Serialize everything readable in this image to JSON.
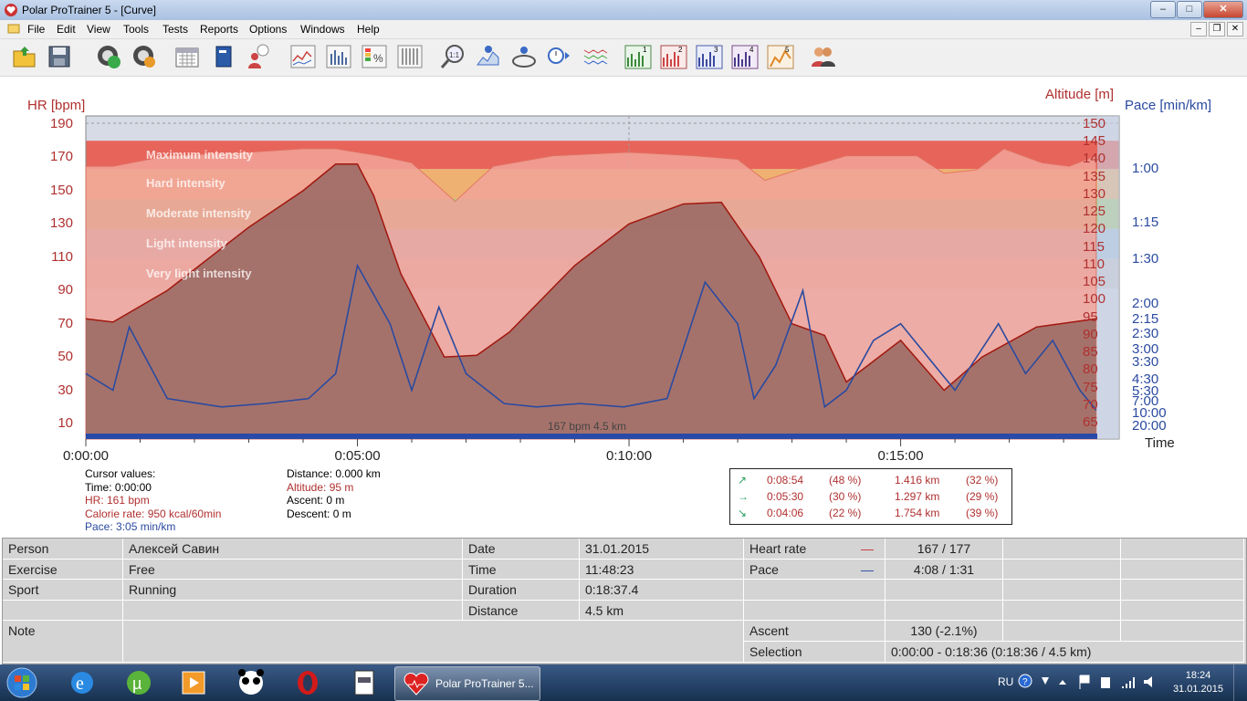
{
  "window": {
    "title": "Polar ProTrainer 5 - [Curve]",
    "min": "–",
    "max": "□",
    "close": "✕"
  },
  "menu": [
    "File",
    "Edit",
    "View",
    "Tools",
    "Tests",
    "Reports",
    "Options",
    "Windows",
    "Help"
  ],
  "mdi": {
    "min": "–",
    "restore": "❐",
    "close": "✕"
  },
  "toolbar_icons": [
    "open-folder-icon",
    "save-icon",
    "sync-icon",
    "settings-gear-icon",
    "calendar-icon",
    "book-icon",
    "person-idea-icon",
    "line-chart-icon",
    "bar-chart-icon",
    "percent-chart-icon",
    "table-icon",
    "zoom-1-1-icon",
    "info-chart-icon",
    "lap-info-icon",
    "timer-swap-icon",
    "multi-line-icon",
    "graph-1-icon",
    "graph-2-icon",
    "graph-3-icon",
    "graph-4-icon",
    "graph-5-icon",
    "users-icon"
  ],
  "toolbar_graph_numbers": [
    "1",
    "2",
    "3",
    "4",
    "5"
  ],
  "chart": {
    "left_axis_label": "HR [bpm]",
    "alt_axis_label": "Altitude [m]",
    "pace_axis_label": "Pace [min/km]",
    "x_axis_label": "Time",
    "hr_ticks": [
      190,
      170,
      150,
      130,
      110,
      90,
      70,
      50,
      30,
      10
    ],
    "alt_ticks": [
      150,
      145,
      140,
      135,
      130,
      125,
      120,
      115,
      110,
      105,
      100,
      95,
      90,
      85,
      80,
      75,
      70,
      65
    ],
    "pace_ticks": [
      "1:00",
      "1:15",
      "1:30",
      "2:00",
      "2:15",
      "2:30",
      "3:00",
      "3:30",
      "4:30",
      "5:30",
      "7:00",
      "10:00",
      "20:00"
    ],
    "x_ticks": [
      "0:00:00",
      "0:05:00",
      "0:10:00",
      "0:15:00"
    ],
    "zones": [
      {
        "label": "Maximum intensity",
        "color": "#e9574a"
      },
      {
        "label": "Hard intensity",
        "color": "#f1ac64"
      },
      {
        "label": "Moderate intensity",
        "color": "#a8c873"
      },
      {
        "label": "Light intensity",
        "color": "#a9c6dc"
      },
      {
        "label": "Very light intensity",
        "color": "#c9c9c9"
      }
    ],
    "bottom_note": "167 bpm 4.5 km",
    "colors": {
      "hr": "#a1180f",
      "pace": "#2a4aa0",
      "alt_fill": "#f2a49a",
      "alt_line": "#e07060",
      "hr_fill": "#9e6c66"
    }
  },
  "chart_data": {
    "type": "line",
    "x_label": "Time",
    "xlim_min": [
      0,
      18.6
    ],
    "series": [
      {
        "name": "HR [bpm]",
        "axis": "hr",
        "x": [
          0,
          0.5,
          1.5,
          3.0,
          4.0,
          4.6,
          5.0,
          5.3,
          5.8,
          6.6,
          7.2,
          7.8,
          9.0,
          10.0,
          11.0,
          11.7,
          12.4,
          13.0,
          13.6,
          14.0,
          15.0,
          15.8,
          16.5,
          17.5,
          18.6
        ],
        "y": [
          73,
          71,
          90,
          128,
          150,
          166,
          166,
          147,
          100,
          50,
          51,
          65,
          105,
          130,
          142,
          143,
          110,
          70,
          63,
          35,
          60,
          30,
          50,
          68,
          73
        ]
      },
      {
        "name": "Altitude [m]",
        "axis": "alt",
        "x": [
          0,
          0.5,
          1.5,
          3.0,
          4.0,
          4.6,
          5.4,
          6.0,
          6.8,
          7.5,
          8.6,
          10.0,
          11.2,
          12.0,
          12.5,
          13.1,
          14.0,
          15.3,
          15.8,
          16.4,
          16.9,
          17.6,
          18.1,
          18.6
        ],
        "y": [
          138,
          138,
          141,
          142,
          143,
          143,
          141,
          139,
          128,
          138,
          141,
          142,
          141,
          140,
          134,
          137,
          141,
          141,
          136,
          137,
          143,
          139,
          138,
          141
        ]
      },
      {
        "name": "Pace [min/km]",
        "axis": "hr",
        "x": [
          0,
          0.5,
          0.8,
          1.5,
          2.5,
          3.3,
          4.1,
          4.6,
          5.0,
          5.6,
          6.0,
          6.5,
          7.0,
          7.7,
          8.3,
          9.1,
          9.9,
          10.7,
          11.4,
          12.0,
          12.3,
          12.7,
          13.2,
          13.6,
          14.0,
          14.5,
          15.0,
          15.5,
          16.0,
          16.5,
          16.8,
          17.3,
          17.8,
          18.3,
          18.6
        ],
        "y": [
          40,
          30,
          68,
          25,
          20,
          22,
          25,
          40,
          105,
          70,
          30,
          80,
          40,
          22,
          20,
          22,
          20,
          25,
          95,
          70,
          25,
          45,
          90,
          20,
          30,
          60,
          70,
          50,
          30,
          55,
          70,
          40,
          60,
          30,
          18
        ]
      }
    ]
  },
  "cursor_values": {
    "header": "Cursor values:",
    "time": "Time: 0:00:00",
    "hr": "HR: 161 bpm",
    "calorie": "Calorie rate: 950 kcal/60min",
    "pace": "Pace: 3:05 min/km",
    "distance": "Distance: 0.000 km",
    "altitude": "Altitude: 95 m",
    "ascent": "Ascent: 0 m",
    "descent": "Descent: 0 m"
  },
  "zone_summary": [
    {
      "arrow": "↗",
      "time": "0:08:54",
      "time_pct": "(48 %)",
      "dist": "1.416 km",
      "dist_pct": "(32 %)"
    },
    {
      "arrow": "→",
      "time": "0:05:30",
      "time_pct": "(30 %)",
      "dist": "1.297 km",
      "dist_pct": "(29 %)"
    },
    {
      "arrow": "↘",
      "time": "0:04:06",
      "time_pct": "(22 %)",
      "dist": "1.754 km",
      "dist_pct": "(39 %)"
    }
  ],
  "info": {
    "person_label": "Person",
    "person": "Алексей Савин",
    "exercise_label": "Exercise",
    "exercise": "Free",
    "sport_label": "Sport",
    "sport": "Running",
    "note_label": "Note",
    "date_label": "Date",
    "date": "31.01.2015",
    "time_label": "Time",
    "time": "11:48:23",
    "duration_label": "Duration",
    "duration": "0:18:37.4",
    "distance_label": "Distance",
    "distance": "4.5 km",
    "hr_label": "Heart rate",
    "hr": "167 / 177",
    "pace_label": "Pace",
    "pace": "4:08 / 1:31",
    "ascent_label": "Ascent",
    "ascent": "130 (-2.1%)",
    "selection_label": "Selection",
    "selection": "0:00:00 - 0:18:36 (0:18:36 / 4.5 km)",
    "hr_line": "—",
    "pace_line": "—"
  },
  "taskbar": {
    "active_task": "Polar ProTrainer 5...",
    "lang": "RU",
    "time": "18:24",
    "date": "31.01.2015"
  }
}
